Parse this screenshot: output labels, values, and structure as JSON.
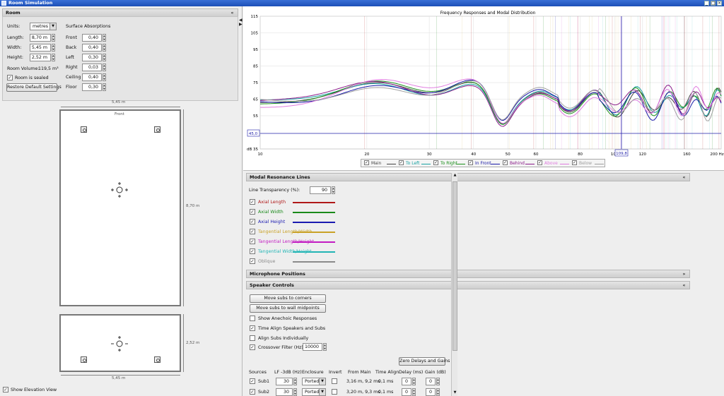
{
  "window": {
    "title": "Room Simulation",
    "minimize": "_",
    "maximize": "□",
    "close": "×"
  },
  "room": {
    "header": "Room",
    "collapse": "«",
    "units_label": "Units:",
    "units_value": "metres",
    "length_label": "Length:",
    "length_value": "8,70 m",
    "width_label": "Width:",
    "width_value": "5,45 m",
    "height_label": "Height:",
    "height_value": "2,52 m",
    "volume_label": "Room Volume:",
    "volume_value": "119,5 m³",
    "sealed_label": "Room is sealed",
    "restore_button": "Restore Default Settings",
    "absorption_header": "Surface Absorptions",
    "absorptions": [
      {
        "label": "Front",
        "value": "0,40"
      },
      {
        "label": "Back",
        "value": "0,40"
      },
      {
        "label": "Left",
        "value": "0,30"
      },
      {
        "label": "Right",
        "value": "0,03"
      },
      {
        "label": "Ceiling",
        "value": "0,40"
      },
      {
        "label": "Floor",
        "value": "0,30"
      }
    ]
  },
  "plan": {
    "top_width": "5,45 m",
    "front_label": "Front",
    "length_side": "8,70 m",
    "elev_height": "2,52 m",
    "elev_width": "5,45 m",
    "show_elevation": "Show Elevation View"
  },
  "chart": {
    "title": "Frequency Responses and Modal Distribution",
    "y_ticks": [
      "115",
      "105",
      "95",
      "85",
      "75",
      "65",
      "55"
    ],
    "y_unit": "dB 35",
    "x_ticks": [
      "10",
      "20",
      "30",
      "40",
      "50",
      "60",
      "80",
      "100",
      "120",
      "160",
      "200 Hz"
    ],
    "cursor_x": "109,8",
    "cursor_y": "45,0",
    "legend": [
      {
        "label": "Main",
        "color": "#444444"
      },
      {
        "label": "To Left",
        "color": "#1aa3a3"
      },
      {
        "label": "To Right",
        "color": "#1a8f1a"
      },
      {
        "label": "In Front",
        "color": "#1a1aa8"
      },
      {
        "label": "Behind",
        "color": "#8a1a8a"
      },
      {
        "label": "Above",
        "color": "#e07be0"
      },
      {
        "label": "Below",
        "color": "#a0a0a0"
      }
    ]
  },
  "modal": {
    "header": "Modal Resonance Lines",
    "transparency_label": "Line Transparency (%):",
    "transparency_value": "90",
    "lines": [
      {
        "label": "Axial Length",
        "color": "#b01818"
      },
      {
        "label": "Axial Width",
        "color": "#1a8a1a"
      },
      {
        "label": "Axial Height",
        "color": "#1a1ab0"
      },
      {
        "label": "Tangential Length/Width",
        "color": "#c9a227"
      },
      {
        "label": "Tangential Length/Height",
        "color": "#c21cc2"
      },
      {
        "label": "Tangential Width/Height",
        "color": "#22b5b5"
      },
      {
        "label": "Oblique",
        "color": "#8a8a8a"
      }
    ]
  },
  "mic": {
    "header": "Microphone Positions"
  },
  "speakers": {
    "header": "Speaker Controls",
    "corners_button": "Move subs to corners",
    "midpoints_button": "Move subs to wall midpoints",
    "anechoic_label": "Show Anechoic Responses",
    "time_align_label": "Time Align Speakers and Subs",
    "align_subs_label": "Align Subs Individually",
    "crossover_label": "Crossover Filter (Hz)",
    "crossover_value": "10000",
    "zero_button": "Zero Delays and Gains",
    "columns": [
      "Sources",
      "LF -3dB (Hz)",
      "Enclosure",
      "Invert",
      "From Main",
      "Time Align",
      "Delay (ms)",
      "Gain (dB)"
    ],
    "rows": [
      {
        "name": "Sub1",
        "lf": "30",
        "enclosure": "Ported",
        "from_main": "3,16 m, 9,2 ms",
        "time_align": "0,1 ms",
        "delay": "0",
        "gain": "0"
      },
      {
        "name": "Sub2",
        "lf": "30",
        "enclosure": "Ported",
        "from_main": "3,20 m, 9,3 ms",
        "time_align": "0,1 ms",
        "delay": "0",
        "gain": "0"
      }
    ]
  }
}
